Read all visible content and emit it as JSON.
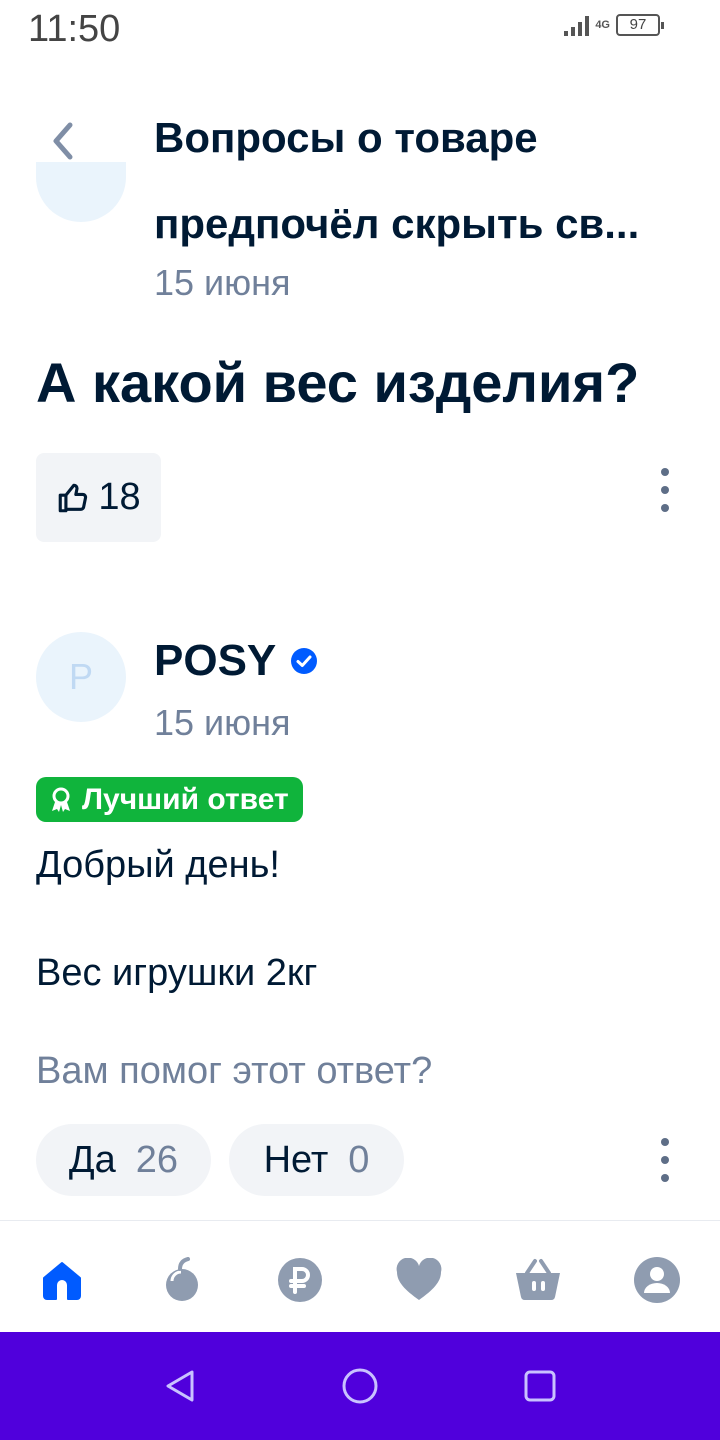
{
  "status_bar": {
    "time": "11:50",
    "network": "4G",
    "battery": "97"
  },
  "header": {
    "title": "Вопросы о товаре"
  },
  "question": {
    "author": "предпочёл скрыть св...",
    "date": "15 июня",
    "text": "А какой вес изделия?",
    "likes": "18"
  },
  "answer": {
    "avatar_letter": "P",
    "author": "POSY",
    "date": "15 июня",
    "badge": "Лучший ответ",
    "lines": [
      "Добрый день!",
      "Вес игрушки 2кг"
    ],
    "helpful_prompt": "Вам помог этот ответ?",
    "yes_label": "Да",
    "yes_count": "26",
    "no_label": "Нет",
    "no_count": "0"
  },
  "colors": {
    "accent": "#005bff",
    "best_badge": "#10b43c",
    "system_nav": "#5000dc",
    "text_primary": "#001a34",
    "text_secondary": "#70809a",
    "nav_icon": "#8f9cb0"
  },
  "bottom_nav": {
    "items": [
      {
        "icon": "home-icon",
        "active": true
      },
      {
        "icon": "fresh-apple-icon",
        "active": false
      },
      {
        "icon": "ruble-icon",
        "active": false
      },
      {
        "icon": "heart-icon",
        "active": false
      },
      {
        "icon": "basket-icon",
        "active": false
      },
      {
        "icon": "profile-icon",
        "active": false
      }
    ]
  },
  "system_nav": {
    "icons": [
      "back-triangle-icon",
      "home-circle-icon",
      "recents-square-icon"
    ]
  }
}
